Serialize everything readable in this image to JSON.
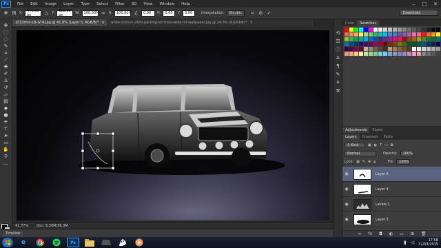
{
  "menubar": {
    "logo": "Ps",
    "items": [
      "File",
      "Edit",
      "Image",
      "Layer",
      "Type",
      "Select",
      "Filter",
      "3D",
      "View",
      "Window",
      "Help"
    ]
  },
  "options": {
    "x_label": "X:",
    "x_value": "446.00 px",
    "y_label": "Y:",
    "y_value": "822.50 px",
    "w_label": "W:",
    "w_value": "100.00%",
    "h_label": "H:",
    "h_value": "100.00%",
    "angle_value": "0.00",
    "hskew_label": "H:",
    "hskew_value": "0.00",
    "vskew_label": "V:",
    "vskew_value": "0.00",
    "interp_label": "Interpolation:",
    "interp_value": "Bicubic",
    "workspace": "Essentials"
  },
  "tabs": [
    {
      "label": "1013mm-LB-GTR.jpg @ 41.8% (Layer 5, RGB/8)*"
    },
    {
      "label": "white-datsun-260z-parking-lot-fram-wide-hd-wallpaper.jpg @ 24.8% (RGB/8#)*"
    }
  ],
  "status": {
    "zoom": "41.77%",
    "doc": "Doc: 8.30M/36.3M"
  },
  "timeline_label": "Timeline",
  "color_panel": {
    "tabs": [
      "Color",
      "Swatches"
    ]
  },
  "swatch_colors": [
    "#ff0000",
    "#ffff00",
    "#00ff00",
    "#00ffff",
    "#0000ff",
    "#ff00ff",
    "#ffffff",
    "#ebebeb",
    "#d6d6d6",
    "#c2c2c2",
    "#adadad",
    "#999999",
    "#858585",
    "#707070",
    "#5c5c5c",
    "#474747",
    "#333333",
    "#1f1f1f",
    "#0a0a0a",
    "#000000",
    "#f26c4f",
    "#f68e56",
    "#fbaf5c",
    "#fff467",
    "#acd372",
    "#7cc576",
    "#3bb878",
    "#1abbb4",
    "#00bff3",
    "#438ccb",
    "#5574b9",
    "#605ca8",
    "#855fa8",
    "#a763a9",
    "#f06ea9",
    "#f26d7d",
    "#ed1c24",
    "#f26522",
    "#f7941d",
    "#fff200",
    "#8dc63f",
    "#39b54a",
    "#00a651",
    "#00a99d",
    "#00aeef",
    "#0072bc",
    "#0054a6",
    "#2e3192",
    "#662d91",
    "#92278f",
    "#ec008c",
    "#ed145b",
    "#9e0b0f",
    "#a0410d",
    "#a36209",
    "#aba000",
    "#598527",
    "#1a7b30",
    "#007236",
    "#00746b",
    "#0076a3",
    "#004b80",
    "#003471",
    "#1b1464",
    "#440e62",
    "#630460",
    "#9e005d",
    "#9e0039",
    "#790000",
    "#7b2e00",
    "#7d4900",
    "#827b00",
    "#406618",
    "#005e20",
    "#005826",
    "#005952",
    "#005b7f",
    "#003663",
    "#002157",
    "#0d004c",
    "#32004b",
    "#4b0049",
    "#7b0046",
    "#7a0026",
    "#c7b299",
    "#998675",
    "#736357",
    "#534741",
    "#37302d",
    "#c69c6d",
    "#a67c52",
    "#8c6239",
    "#754c24",
    "#603913",
    "#ffffff",
    "#ebebeb",
    "#d6d6d6",
    "#c2c2c2",
    "#adadad",
    "#999999",
    "#f7977a",
    "#f9ad81",
    "#fdc68a",
    "#fff79a",
    "#c4df9b",
    "#a3d39c",
    "#82ca9d",
    "#7bcdc8",
    "#6ecff6",
    "#7ea7d8",
    "#8493ca",
    "#8882be",
    "#a187be",
    "#bc8dbf",
    "#f49ac2",
    "#f6989d",
    "#858585",
    "#707070",
    "#5c5c5c",
    "#474747"
  ],
  "adjustments": {
    "tabs": [
      "Adjustments",
      "Styles"
    ]
  },
  "layers": {
    "tabs": [
      "Layers",
      "Channels",
      "Paths"
    ],
    "kind_label": "Kind",
    "blend_mode": "Normal",
    "opacity_label": "Opacity:",
    "opacity_value": "100%",
    "lock_label": "Lock:",
    "fill_label": "Fill:",
    "fill_value": "100%",
    "items": [
      {
        "name": "Layer 5"
      },
      {
        "name": "Layer 4"
      },
      {
        "name": "Levels 1"
      },
      {
        "name": "Layer 3"
      }
    ]
  },
  "taskbar": {
    "apps": [
      "Ps"
    ],
    "time": "17:58",
    "date": "11/03/2015"
  }
}
